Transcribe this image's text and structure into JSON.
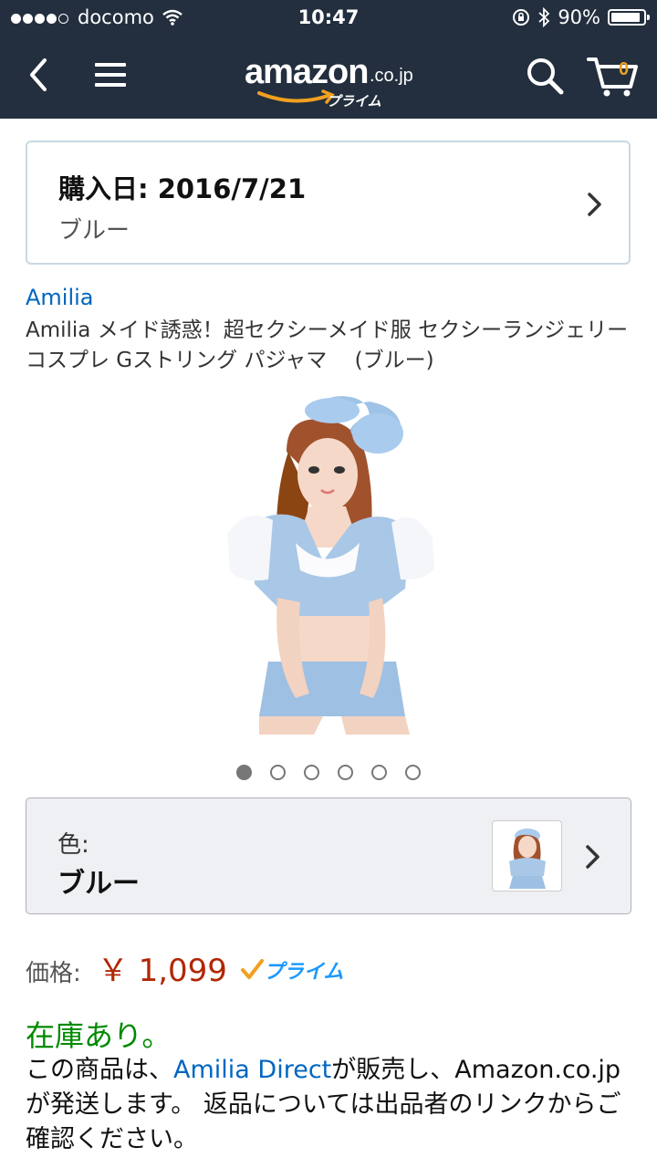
{
  "status_bar": {
    "carrier": "docomo",
    "time": "10:47",
    "battery": "90%",
    "battery_level": 0.9
  },
  "header": {
    "logo_word": "amazon",
    "logo_domain": ".co.jp",
    "logo_prime": "プライム",
    "cart_count": "0",
    "icons": [
      "back-icon",
      "menu-icon",
      "search-icon",
      "cart-icon"
    ]
  },
  "order": {
    "date": "購入日: 2016/7/21",
    "color": "ブルー"
  },
  "product": {
    "brand": "Amilia",
    "title": "Amilia メイド誘惑！超セクシーメイド服 セクシーランジェリー コスプレ Gストリング パジャマ　 (ブルー)",
    "image_count": 6,
    "active_image": 1
  },
  "variation": {
    "label": "色:",
    "value": "ブルー"
  },
  "price": {
    "label": "価格:",
    "value": "￥ 1,099",
    "prime_badge": "プライム"
  },
  "availability": {
    "stock": "在庫あり。",
    "seller_prefix": "この商品は、",
    "seller_name": "Amilia Direct",
    "seller_suffix": "が販売し、Amazon.co.jp が発送します。 返品については出品者のリンクからご確認ください。"
  },
  "colors": {
    "header_bg": "#232f3e",
    "link": "#0066c0",
    "price": "#b12704",
    "in_stock": "#008a00",
    "prime": "#1a98ff"
  }
}
